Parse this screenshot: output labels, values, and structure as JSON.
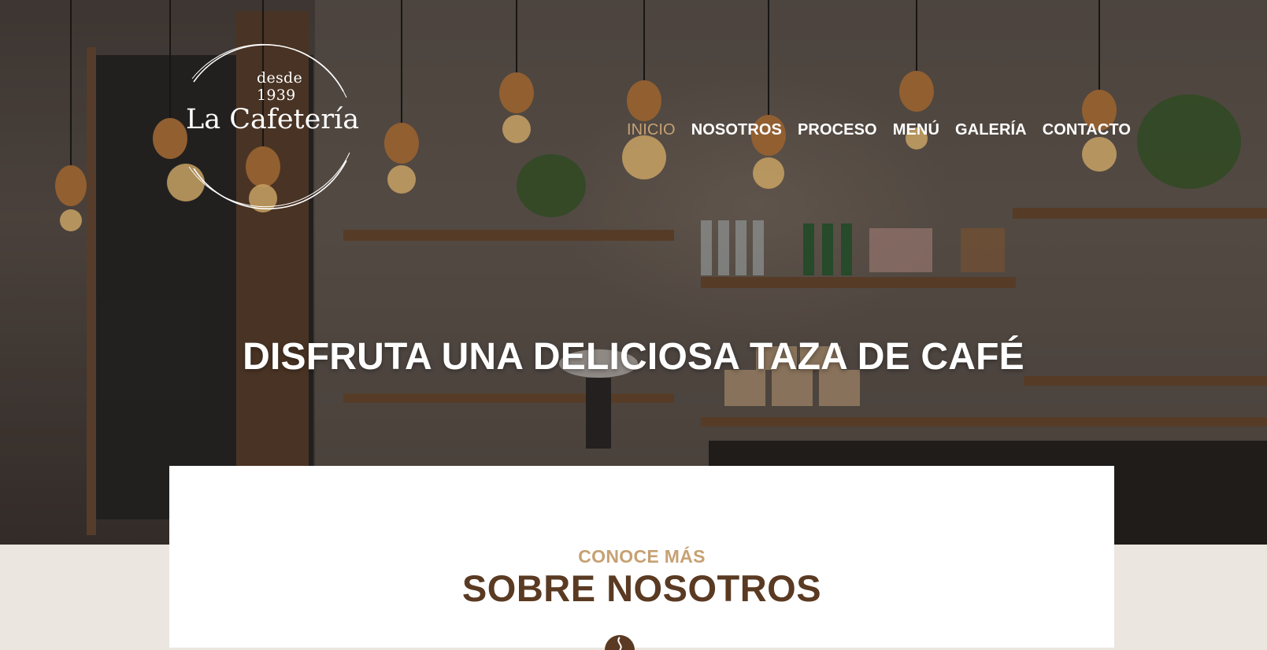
{
  "brand": {
    "since": "desde 1939",
    "name": "La Cafetería"
  },
  "nav": {
    "items": [
      {
        "label": "INICIO",
        "active": true
      },
      {
        "label": "NOSOTROS",
        "active": false
      },
      {
        "label": "PROCESO",
        "active": false
      },
      {
        "label": "MENÚ",
        "active": false
      },
      {
        "label": "GALERÍA",
        "active": false
      },
      {
        "label": "CONTACTO",
        "active": false
      }
    ]
  },
  "hero": {
    "headline": "DISFRUTA UNA DELICIOSA TAZA DE CAFÉ"
  },
  "about": {
    "eyebrow": "CONOCE MÁS",
    "title": "SOBRE NOSOTROS"
  },
  "colors": {
    "accent": "#c6a173",
    "heading": "#5a3a22",
    "page_background": "#ebe6df"
  },
  "icons": {
    "divider": "coffee-bean-icon"
  }
}
